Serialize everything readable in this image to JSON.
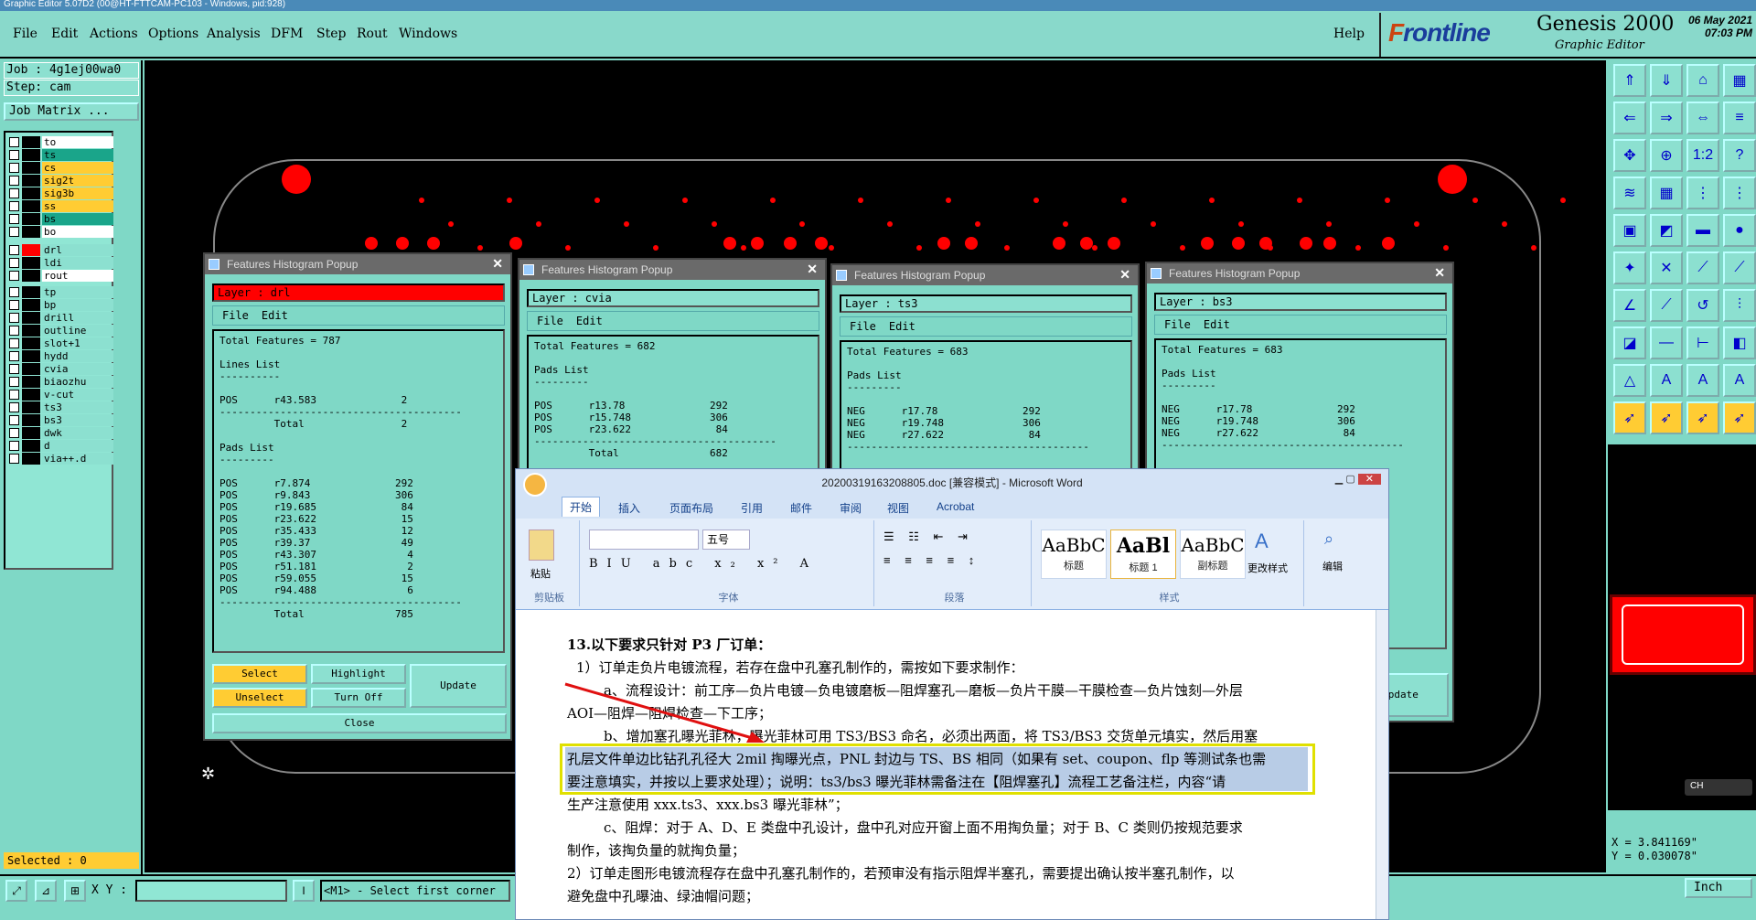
{
  "window_title": "Graphic Editor 5.07D2 (00@HT-FTTCAM-PC103 - Windows, pid:928)",
  "menu": [
    "File",
    "Edit",
    "Actions",
    "Options",
    "Analysis",
    "DFM",
    "Step",
    "Rout",
    "Windows"
  ],
  "help": "Help",
  "brand": {
    "logo_a": "F",
    "logo_b": "rontline",
    "title": "Genesis 2000",
    "subtitle": "Graphic Editor",
    "date": "06 May 2021",
    "time": "07:03 PM"
  },
  "left": {
    "job": "Job : 4g1ej00wa0",
    "step": "Step: cam",
    "job_matrix": "Job Matrix ...",
    "selected": "Selected : 0"
  },
  "layers": [
    {
      "name": "to",
      "color": "#ffffff"
    },
    {
      "name": "ts",
      "color": "#1aa58a"
    },
    {
      "name": "cs",
      "color": "#ffcc33"
    },
    {
      "name": "sig2t",
      "color": "#ffcc33"
    },
    {
      "name": "sig3b",
      "color": "#ffcc33"
    },
    {
      "name": "ss",
      "color": "#ffcc33"
    },
    {
      "name": "bs",
      "color": "#1aa58a"
    },
    {
      "name": "bo",
      "color": "#ffffff"
    },
    {
      "name": "drl",
      "color": "#8ce0d0"
    },
    {
      "name": "ldi",
      "color": "#8ce0d0"
    },
    {
      "name": "rout",
      "color": "#ffffff"
    },
    {
      "name": "tp",
      "color": "#8ce0d0"
    },
    {
      "name": "bp",
      "color": "#8ce0d0"
    },
    {
      "name": "drill",
      "color": "#8ce0d0"
    },
    {
      "name": "outline",
      "color": "#8ce0d0"
    },
    {
      "name": "slot+1",
      "color": "#8ce0d0"
    },
    {
      "name": "hydd",
      "color": "#8ce0d0"
    },
    {
      "name": "cvia",
      "color": "#8ce0d0"
    },
    {
      "name": "biaozhu",
      "color": "#8ce0d0"
    },
    {
      "name": "v-cut",
      "color": "#8ce0d0"
    },
    {
      "name": "ts3",
      "color": "#8ce0d0"
    },
    {
      "name": "bs3",
      "color": "#8ce0d0"
    },
    {
      "name": "dwk",
      "color": "#8ce0d0"
    },
    {
      "name": "d",
      "color": "#8ce0d0"
    },
    {
      "name": "via++.d",
      "color": "#8ce0d0"
    }
  ],
  "popups": [
    {
      "title": "Features Histogram Popup",
      "layer": "Layer :  drl",
      "file": "File",
      "edit": "Edit",
      "body": "Total Features = 787\n\nLines List\n----------\n\nPOS      r43.583              2\n----------------------------------------\n         Total                2\n\nPads List\n---------\n\nPOS      r7.874              292\nPOS      r9.843              306\nPOS      r19.685              84\nPOS      r23.622              15\nPOS      r35.433              12\nPOS      r39.37               49\nPOS      r43.307               4\nPOS      r51.181               2\nPOS      r59.055              15\nPOS      r94.488               6\n----------------------------------------\n         Total               785",
      "select": "Select",
      "unselect": "Unselect",
      "highlight": "Highlight",
      "turnoff": "Turn Off",
      "update": "Update",
      "close": "Close"
    },
    {
      "title": "Features Histogram Popup",
      "layer": "Layer :  cvia",
      "file": "File",
      "edit": "Edit",
      "body": "Total Features = 682\n\nPads List\n---------\n\nPOS      r13.78              292\nPOS      r15.748             306\nPOS      r23.622              84\n----------------------------------------\n         Total               682"
    },
    {
      "title": "Features Histogram Popup",
      "layer": "Layer :  ts3",
      "file": "File",
      "edit": "Edit",
      "body": "Total Features = 683\n\nPads List\n---------\n\nNEG      r17.78              292\nNEG      r19.748             306\nNEG      r27.622              84\n----------------------------------------"
    },
    {
      "title": "Features Histogram Popup",
      "layer": "Layer :  bs3",
      "file": "File",
      "edit": "Edit",
      "body": "Total Features = 683\n\nPads List\n---------\n\nNEG      r17.78              292\nNEG      r19.748             306\nNEG      r27.622              84\n----------------------------------------",
      "update": "Update"
    }
  ],
  "word": {
    "title": "20200319163208805.doc [兼容模式] - Microsoft Word",
    "tabs": [
      "开始",
      "插入",
      "页面布局",
      "引用",
      "邮件",
      "审阅",
      "视图",
      "Acrobat"
    ],
    "groups": {
      "clipboard": "剪贴板",
      "font": "字体",
      "paragraph": "段落",
      "styles": "样式",
      "edit": "编辑"
    },
    "paste": "粘贴",
    "font_size": "五号",
    "change_styles": "更改样式",
    "styles": [
      {
        "sample": "AaBbC",
        "name": "标题"
      },
      {
        "sample": "AaBl",
        "name": "标题 1"
      },
      {
        "sample": "AaBbC",
        "name": "副标题"
      }
    ],
    "lines": [
      "13.以下要求只针对 P3 厂订单：",
      "1）订单走负片电镀流程，若存在盘中孔塞孔制作的，需按如下要求制作：",
      "a、流程设计：前工序—负片电镀—负电镀磨板—阻焊塞孔—磨板—负片干膜—干膜检查—负片蚀刻—外层",
      "AOI—阻焊—阻焊检查—下工序；",
      "b、增加塞孔曝光菲林，曝光菲林可用 TS3/BS3 命名，必须出两面，将 TS3/BS3 交货单元填实，然后用塞",
      "孔层文件单边比钻孔孔径大 2mil 掏曝光点，PNL 封边与 TS、BS 相同（如果有 set、coupon、flp 等测试条也需",
      "要注意填实，并按以上要求处理）；说明：ts3/bs3 曝光菲林需备注在【阻焊塞孔】流程工艺备注栏，内容“请",
      "生产注意使用 xxx.ts3、xxx.bs3 曝光菲林”；",
      "c、阻焊：对于 A、D、E 类盘中孔设计，盘中孔对应开窗上面不用掏负量；对于 B、C 类则仍按规范要求",
      "制作，该掏负量的就掏负量；",
      "2）订单走图形电镀流程存在盘中孔塞孔制作的，若预审没有指示阻焊半塞孔，需要提出确认按半塞孔制作，以",
      "避免盘中孔曝油、绿油帽问题；"
    ]
  },
  "coords": {
    "x": "X = 3.841169\"",
    "y": "Y = 0.030078\""
  },
  "unit": "Inch",
  "ch": "CH",
  "xy_label": "X Y :",
  "status": "<M1> - Select first corner"
}
